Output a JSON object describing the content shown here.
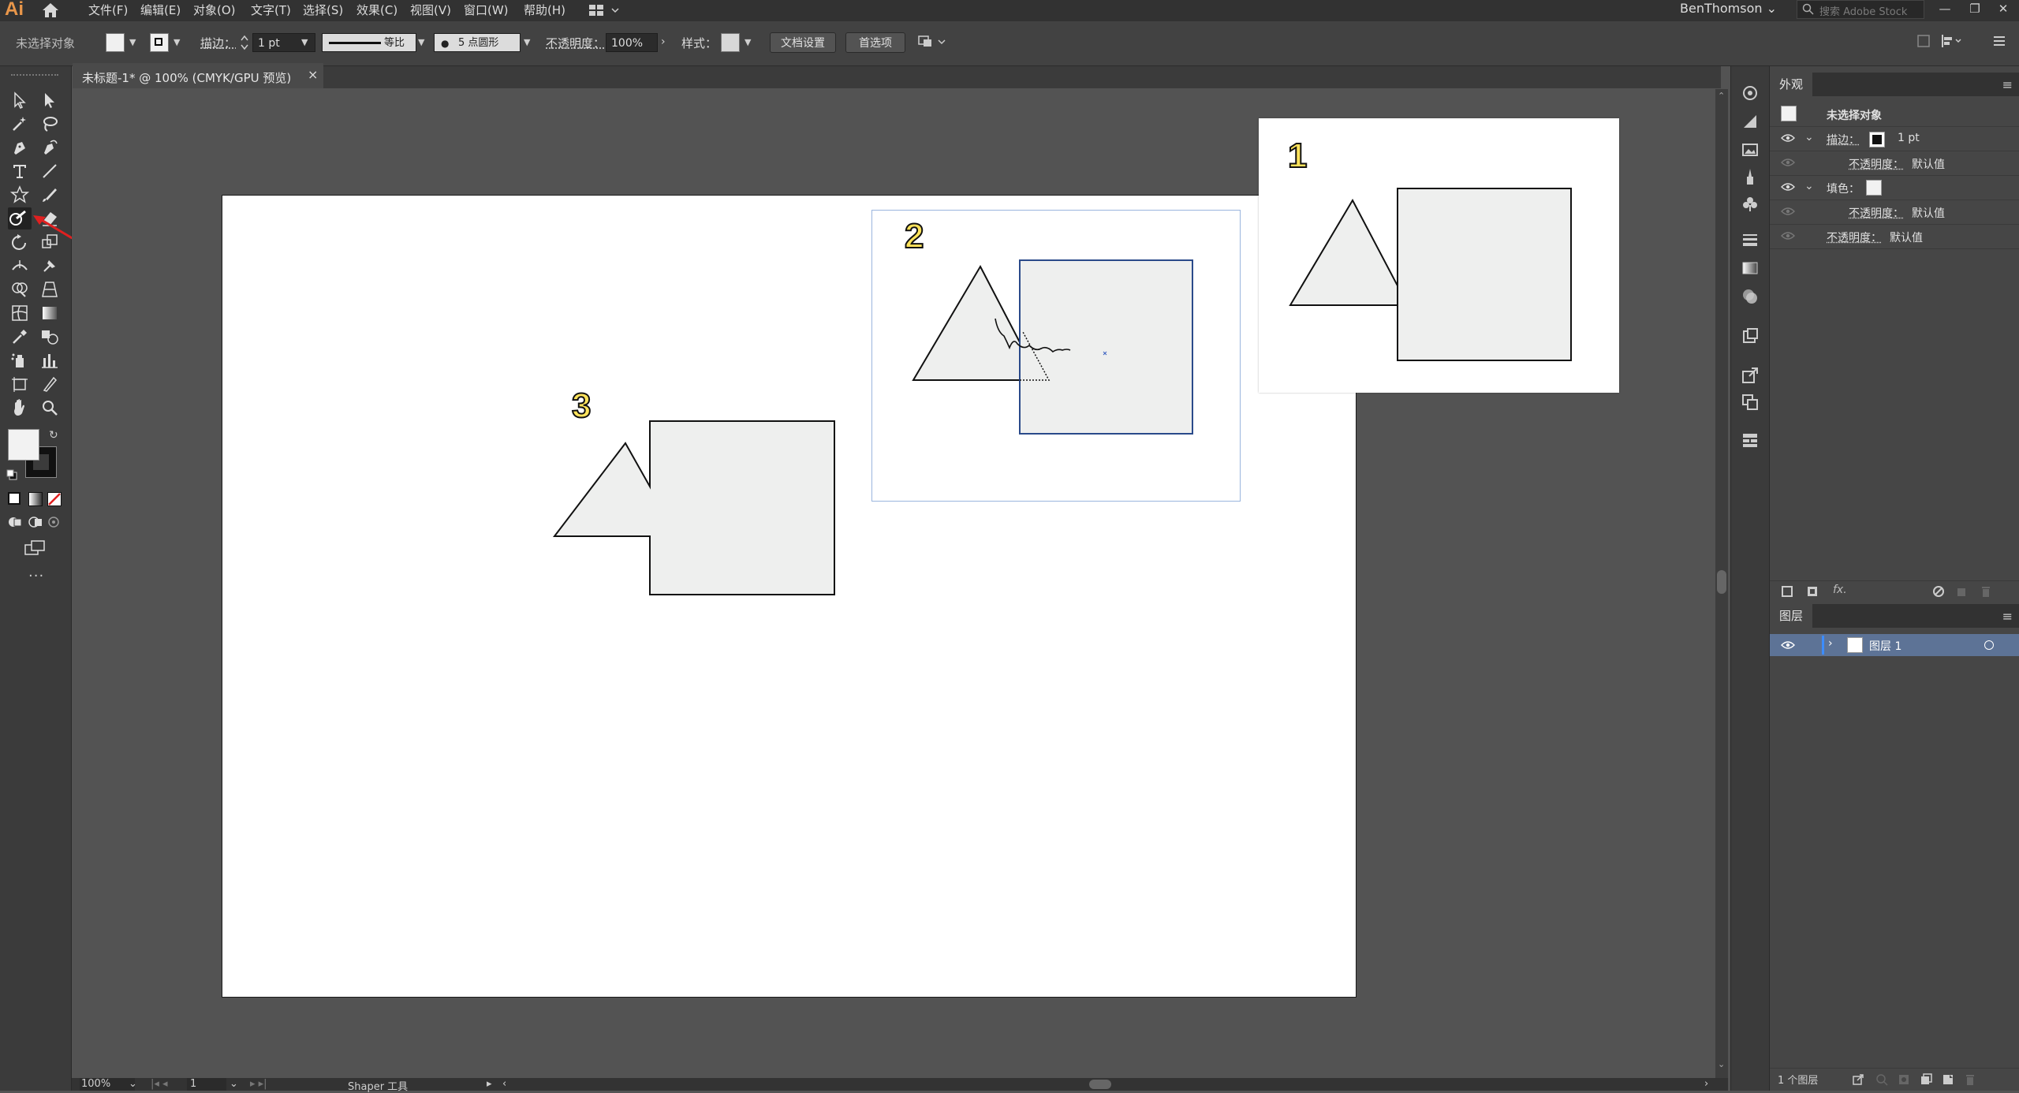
{
  "app": {
    "logo": "Ai",
    "menu": [
      "文件(F)",
      "编辑(E)",
      "对象(O)",
      "文字(T)",
      "选择(S)",
      "效果(C)",
      "视图(V)",
      "窗口(W)",
      "帮助(H)"
    ],
    "user": "BenThomson",
    "stock_search_placeholder": "搜索 Adobe Stock",
    "window_controls": [
      "—",
      "❐",
      "✕"
    ]
  },
  "control_bar": {
    "selection_label": "未选择对象",
    "stroke_label": "描边：",
    "stroke_value": "1 pt",
    "stroke_profile": "等比",
    "brush_label": "5 点圆形",
    "opacity_label": "不透明度：",
    "opacity_value": "100%",
    "style_label": "样式：",
    "doc_setup_button": "文档设置",
    "preferences_button": "首选项"
  },
  "document": {
    "tab_title": "未标题-1* @ 100% (CMYK/GPU 预览)",
    "tab_close": "×"
  },
  "canvas": {
    "labels": [
      "1",
      "2",
      "3"
    ]
  },
  "status_bar": {
    "zoom": "100%",
    "artboard_number": "1",
    "tool_name": "Shaper 工具"
  },
  "appearance_panel": {
    "tab": "外观",
    "header": "未选择对象",
    "rows": [
      {
        "label": "描边：",
        "value": "1 pt"
      },
      {
        "label": "不透明度：",
        "value": "默认值"
      },
      {
        "label": "填色：",
        "value": ""
      },
      {
        "label": "不透明度：",
        "value": "默认值"
      },
      {
        "label": "不透明度：",
        "value": "默认值"
      }
    ],
    "fx_label": "fx."
  },
  "layers_panel": {
    "tab": "图层",
    "layer_name": "图层 1",
    "layer_count": "1 个图层"
  },
  "colors": {
    "accent_orange": "#e8964a",
    "label_yellow": "#ffe35c",
    "selection_blue": "#2a4a8a",
    "shape_fill": "#eeefee",
    "layer_highlight": "#5d7396"
  }
}
